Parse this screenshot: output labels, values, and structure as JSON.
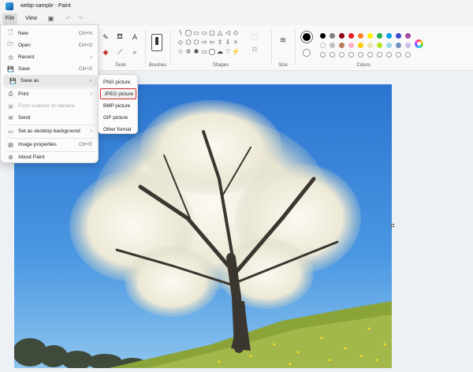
{
  "window": {
    "title": "webp-sample - Paint"
  },
  "menubar": {
    "file": "File",
    "view": "View"
  },
  "ribbon": {
    "tools_label": "Tools",
    "brushes_label": "Brushes",
    "shapes_label": "Shapes",
    "size_label": "Size",
    "colors_label": "Colors",
    "text_tool_glyph": "A",
    "shape_glyphs": [
      "\\",
      "◯",
      "▭",
      "▭",
      "▢",
      "△",
      "◁",
      "◇",
      "◇",
      "⬠",
      "⬡",
      "⇨",
      "⇦",
      "⇧",
      "⇩",
      "✧",
      "☆",
      "✡",
      "✱",
      "▭",
      "◯",
      "☁",
      "♡",
      "⚡"
    ],
    "palette": [
      "#000000",
      "#7f7f7f",
      "#880015",
      "#ed1c24",
      "#ff7f27",
      "#fff200",
      "#22b14c",
      "#00a2e8",
      "#3f48cc",
      "#a349a4",
      "#ffffff",
      "#c3c3c3",
      "#b97a57",
      "#ffaec9",
      "#ffc90e",
      "#efe4b0",
      "#b5e61d",
      "#99d9ea",
      "#7092be",
      "#c8bfe7",
      "empty",
      "empty",
      "empty",
      "empty",
      "empty",
      "empty",
      "empty",
      "empty",
      "empty",
      "empty"
    ]
  },
  "file_menu": {
    "items": [
      {
        "label": "New",
        "shortcut": "Ctrl+N",
        "icon": "new-file-icon",
        "glyph": "🗋"
      },
      {
        "label": "Open",
        "shortcut": "Ctrl+O",
        "icon": "open-folder-icon",
        "glyph": "🗁"
      },
      {
        "label": "Recent",
        "arrow": "›",
        "icon": "recent-icon",
        "glyph": "◷"
      },
      {
        "label": "Save",
        "shortcut": "Ctrl+S",
        "icon": "save-icon",
        "glyph": "💾"
      },
      {
        "label": "Save as",
        "arrow": "›",
        "icon": "save-as-icon",
        "glyph": "💾"
      },
      {
        "label": "Print",
        "arrow": "›",
        "icon": "print-icon",
        "glyph": "⎙"
      },
      {
        "label": "From scanner or camera",
        "icon": "scanner-icon",
        "glyph": "▣"
      },
      {
        "label": "Send",
        "icon": "send-icon",
        "glyph": "✉"
      },
      {
        "label": "Set as desktop background",
        "arrow": "›",
        "icon": "desktop-background-icon",
        "glyph": "▭"
      },
      {
        "label": "Image properties",
        "shortcut": "Ctrl+E",
        "icon": "image-properties-icon",
        "glyph": "▤"
      },
      {
        "label": "About Paint",
        "icon": "settings-icon",
        "glyph": "⚙"
      }
    ]
  },
  "save_as_submenu": {
    "items": [
      "PNG picture",
      "JPEG picture",
      "BMP picture",
      "GIF picture",
      "Other format"
    ]
  }
}
